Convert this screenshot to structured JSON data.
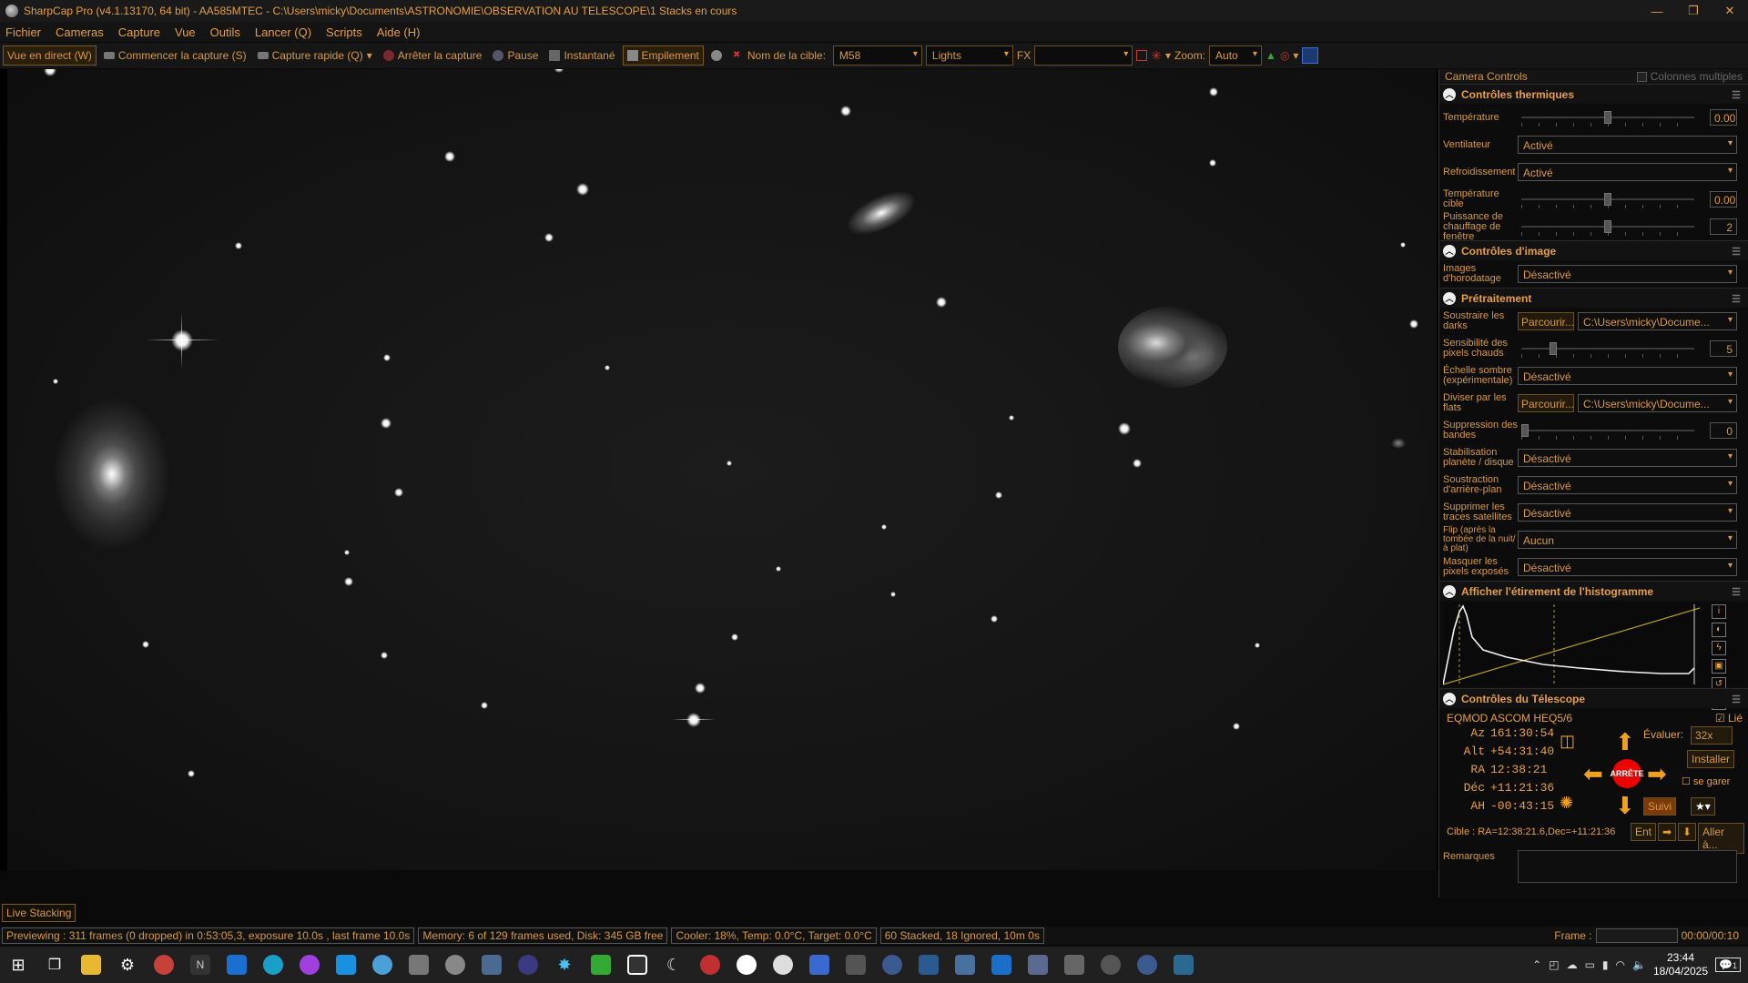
{
  "window": {
    "title": "SharpCap Pro (v4.1.13170, 64 bit) - AA585MTEC - C:\\Users\\micky\\Documents\\ASTRONOMIE\\OBSERVATION AU TELESCOPE\\1 Stacks en cours",
    "controls": [
      "minimize-icon",
      "maximize-icon",
      "close-icon"
    ]
  },
  "menu": [
    "Fichier",
    "Cameras",
    "Capture",
    "Vue",
    "Outils",
    "Lancer (Q)",
    "Scripts",
    "Aide (H)"
  ],
  "toolbar": {
    "live_view": "Vue en direct (W)",
    "start_capture": "Commencer la capture (S)",
    "quick_capture": "Capture rapide (Q)",
    "stop_capture": "Arrêter la capture",
    "pause": "Pause",
    "snapshot": "Instantané",
    "stacking": "Empilement",
    "target_label": "Nom de la cible:",
    "target_value": "M58",
    "frame_type": "Lights",
    "fx_label": "FX",
    "fx_value": "",
    "zoom_label": "Zoom:",
    "zoom_value": "Auto"
  },
  "viewport": {
    "live_stacking_tag": "Live Stacking"
  },
  "status": {
    "preview": "Previewing : 311 frames (0 dropped) in 0:53:05,3, exposure 10.0s , last frame 10.0s",
    "memory": "Memory: 6 of 129 frames used, Disk: 345 GB free",
    "cooler": "Cooler: 18%, Temp: 0.0°C, Target: 0.0°C",
    "stack": "60 Stacked, 18 Ignored, 10m 0s",
    "frame_label": "Frame :",
    "time": "00:00/00:10"
  },
  "panel": {
    "header": "Camera Controls",
    "multi_columns": "Colonnes multiples",
    "thermal": {
      "title": "Contrôles thermiques",
      "temperature_label": "Température",
      "temperature_value": "0.00",
      "temperature_level": 0.5,
      "fan_label": "Ventilateur",
      "fan_value": "Activé",
      "cooling_label": "Refroidissement",
      "cooling_value": "Activé",
      "target_temp_label": "Température cible",
      "target_temp_value": "0.00",
      "target_temp_level": 0.5,
      "heater_label": "Puissance de chauffage de fenêtre",
      "heater_value": "2",
      "heater_level": 0.5
    },
    "image": {
      "title": "Contrôles d'image",
      "timestamp_label": "Images d'horodatage",
      "timestamp_value": "Désactivé"
    },
    "preprocessing": {
      "title": "Prétraitement",
      "darks_label": "Soustraire les darks",
      "browse": "Parcourir...",
      "darks_path": "C:\\Users\\micky\\Docume...",
      "hotpix_label": "Sensibilité des pixels chauds",
      "hotpix_value": "5",
      "hotpix_level": 0.17,
      "dark_scale_label": "Échelle sombre (expérimentale)",
      "dark_scale_value": "Désactivé",
      "flats_label": "Diviser par les flats",
      "flats_path": "C:\\Users\\micky\\Docume...",
      "banding_label": "Suppression des bandes",
      "banding_value": "0",
      "banding_level": 0.0,
      "stabilisation_label": "Stabilisation planète / disque",
      "stabilisation_value": "Désactivé",
      "bg_sub_label": "Soustraction d'arrière-plan",
      "bg_sub_value": "Désactivé",
      "sat_trail_label": "Supprimer les traces satellites",
      "sat_trail_value": "Désactivé",
      "flip_label": "Flip (après la tombée de la nuit/à plat)",
      "flip_value": "Aucun",
      "mask_label": "Masquer les pixels exposés",
      "mask_value": "Désactivé"
    },
    "histogram": {
      "title": "Afficher l'étirement de l'histogramme"
    },
    "telescope": {
      "title": "Contrôles du Télescope",
      "mount": "EQMOD ASCOM HEQ5/6",
      "linked_label": "Lié",
      "az_label": "Az",
      "az_value": "161:30:54",
      "alt_label": "Alt",
      "alt_value": "+54:31:40",
      "ra_label": "RA",
      "ra_value": "12:38:21",
      "dec_label": "Déc",
      "dec_value": "+11:21:36",
      "ha_label": "AH",
      "ha_value": "-00:43:15",
      "stop": "ARRÊTE",
      "rate_label": "Évaluer:",
      "rate_value": "32x",
      "install": "Installer",
      "park_label": "se garer",
      "track": "Suivi",
      "target_line": "Cible : RA=12:38:21.6,Dec=+11:21:36",
      "enter": "Ent",
      "goto": "Aller à..."
    },
    "notes_label": "Remarques"
  },
  "taskbar": {
    "time": "23:44",
    "date": "18/04/2025",
    "notif": "1"
  },
  "colors": {
    "accent": "#e6a040",
    "stop": "#e00000",
    "arrow": "#f0a020"
  }
}
